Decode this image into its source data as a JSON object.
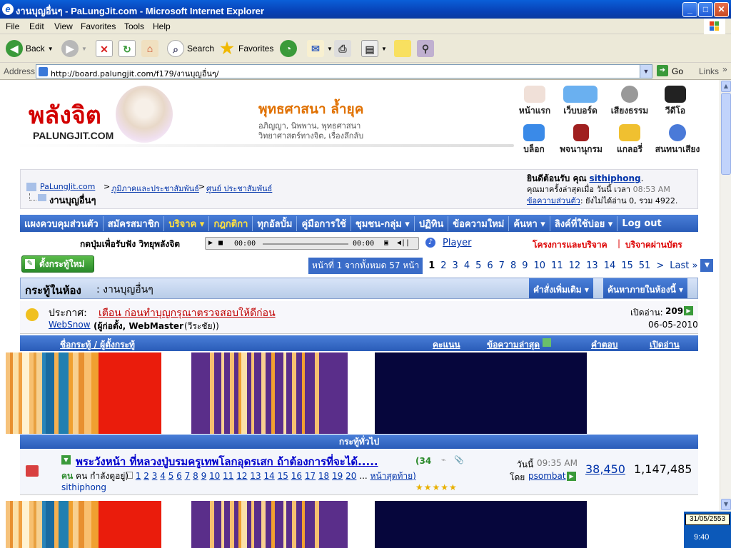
{
  "window": {
    "title": "งานบุญอื่นๆ - PaLungJit.com - Microsoft Internet Explorer",
    "min": "_",
    "max": "□",
    "close": "✕"
  },
  "menu": [
    "File",
    "Edit",
    "View",
    "Favorites",
    "Tools",
    "Help"
  ],
  "toolbar": {
    "back": "Back",
    "search": "Search",
    "favorites": "Favorites"
  },
  "address": {
    "label": "Address",
    "url": "http://board.palungjit.com/f179/งานบุญอื่นๆ/",
    "go": "Go",
    "links": "Links"
  },
  "header": {
    "logo_th": "พลังจิต",
    "logo_en": "PALUNGJIT.COM",
    "title": "พุทธศาสนา ล้ำยุค",
    "sub1": "อภิญญา, นิพพาน, พุทธศาสนา",
    "sub2": "วิทยาศาสตร์ทางจิต, เรื่องลึกลับ",
    "nav_top": [
      "หน้าแรก",
      "เว็บบอร์ด",
      "เสียงธรรม",
      "วีดีโอ"
    ],
    "nav_bottom": [
      "บล็อก",
      "พจนานุกรม",
      "แกลอรี่",
      "สนทนาเสียง"
    ]
  },
  "breadcrumb": {
    "root": "PaLungJit.com",
    "c1": "ภูมิภาคและประชาสัมพันธ์",
    "c2": "ศูนย์ ประชาสัมพันธ์",
    "current": "งานบุญอื่นๆ",
    "sep": ">"
  },
  "welcome": {
    "prefix": "ยินดีต้อนรับ คุณ",
    "user": "sithiphong",
    "last_visit_label": "คุณมาครั้งล่าสุดเมื่อ วันนี้ เวลา",
    "last_visit_time": "08:53 AM",
    "pm_link": "ข้อความส่วนตัว",
    "pm_text": ": ยังไม่ได้อ่าน 0, รวม 4922."
  },
  "navbar": [
    "แผงควบคุมส่วนตัว",
    "สมัครสมาชิก",
    "บริจาค ▾",
    "กฎกติกา",
    "ทุกอัลบั้ม",
    "คู่มือการใช้",
    "ชุมชน-กลุ่ม ▾",
    "ปฏิทิน",
    "ข้อความใหม่",
    "ค้นหา ▾",
    "ลิงค์ที่ใช้บ่อย ▾",
    "Log out"
  ],
  "radio": {
    "label": "กดปุ่มเพื่อรับฟัง วิทยุพลังจิต",
    "time1": "00:00",
    "time2": "00:00",
    "player_link": "Player",
    "projects": "โครงการและบริจาค",
    "sep": "|",
    "card": "บริจาคผ่านบัตร"
  },
  "new_thread": "ตั้งกระทู้ใหม่",
  "pager": {
    "label": "หน้าที่ 1 จากทั้งหมด 57 หน้า",
    "pages": [
      "1",
      "2",
      "3",
      "4",
      "5",
      "6",
      "7",
      "8",
      "9",
      "10",
      "11",
      "12",
      "13",
      "14",
      "15",
      "51",
      ">",
      "Last »"
    ]
  },
  "forum": {
    "label": "กระทู้ในห้อง",
    "name": ": งานบุญอื่นๆ",
    "more": "คำสั่งเพิ่มเติม ▾",
    "search": "ค้นหาภายในห้องนี้ ▾"
  },
  "announce": {
    "label": "ประกาศ:",
    "title": "เตือน ก่อนทำบุญกรุณาตรวจสอบให้ดีก่อน",
    "author": "WebSnow",
    "author_note": "(ผู้ก่อตั้ง, WebMaster",
    "author_note2": "(วีระชัย))",
    "views_label": "เปิดอ่าน:",
    "views": "209",
    "date": "06-05-2010"
  },
  "columns": {
    "title": "ชื่อกระทู้ / ผู้ตั้งกระทู้",
    "rating": "คะแนน",
    "last": "ข้อความล่าสุด",
    "replies": "คำตอบ",
    "views": "เปิดอ่าน"
  },
  "section": "กระทู้ทั่วไป",
  "thread": {
    "title": "พระวังหน้า ที่หลวงปู่บรมครูเทพโลกอุดรเสก ถ้าต้องการที่จะได้.....",
    "count": "(34",
    "viewing": "คน กำลังดูอยู่)",
    "pages": [
      "1",
      "2",
      "3",
      "4",
      "5",
      "6",
      "7",
      "8",
      "9",
      "10",
      "11",
      "12",
      "13",
      "14",
      "15",
      "16",
      "17",
      "18",
      "19",
      "20"
    ],
    "ellipsis": "...",
    "last_page": "หน้าสุดท้าย)",
    "author": "sithiphong",
    "last_day": "วันนี้",
    "last_time": "09:35 AM",
    "last_by_label": "โดย",
    "last_by": "psombat",
    "replies": "38,450",
    "views": "1,147,485",
    "stars": "★★★★★"
  },
  "tray": {
    "date": "31/05/2553",
    "time": "9:40"
  }
}
